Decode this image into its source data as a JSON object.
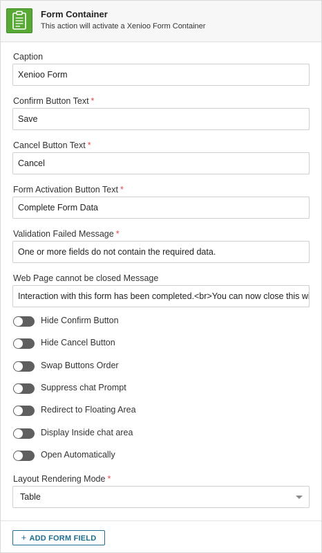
{
  "header": {
    "title": "Form Container",
    "subtitle": "This action will activate a Xenioo Form Container",
    "icon": "form-clipboard-icon",
    "icon_color": "#57a835"
  },
  "fields": [
    {
      "label": "Caption",
      "required": false,
      "value": "Xenioo Form"
    },
    {
      "label": "Confirm Button Text",
      "required": true,
      "value": "Save"
    },
    {
      "label": "Cancel Button Text",
      "required": true,
      "value": "Cancel"
    },
    {
      "label": "Form Activation Button Text",
      "required": true,
      "value": "Complete Form Data"
    },
    {
      "label": "Validation Failed Message",
      "required": true,
      "value": "One or more fields do not contain the required data."
    },
    {
      "label": "Web Page cannot be closed Message",
      "required": false,
      "value": "Interaction with this form has been completed.<br>You can now close this window."
    }
  ],
  "required_marker": "*",
  "toggles": [
    {
      "label": "Hide Confirm Button",
      "on": false
    },
    {
      "label": "Hide Cancel Button",
      "on": false
    },
    {
      "label": "Swap Buttons Order",
      "on": false
    },
    {
      "label": "Suppress chat Prompt",
      "on": false
    },
    {
      "label": "Redirect to Floating Area",
      "on": false
    },
    {
      "label": "Display Inside chat area",
      "on": false
    },
    {
      "label": "Open Automatically",
      "on": false
    }
  ],
  "layout_mode": {
    "label": "Layout Rendering Mode",
    "required": true,
    "value": "Table"
  },
  "footer": {
    "add_button_plus": "+",
    "add_button_label": "ADD FORM FIELD"
  },
  "colors": {
    "accent": "#1d6d93",
    "required": "#e04a4a",
    "toggle_off": "#5f5f5f"
  }
}
